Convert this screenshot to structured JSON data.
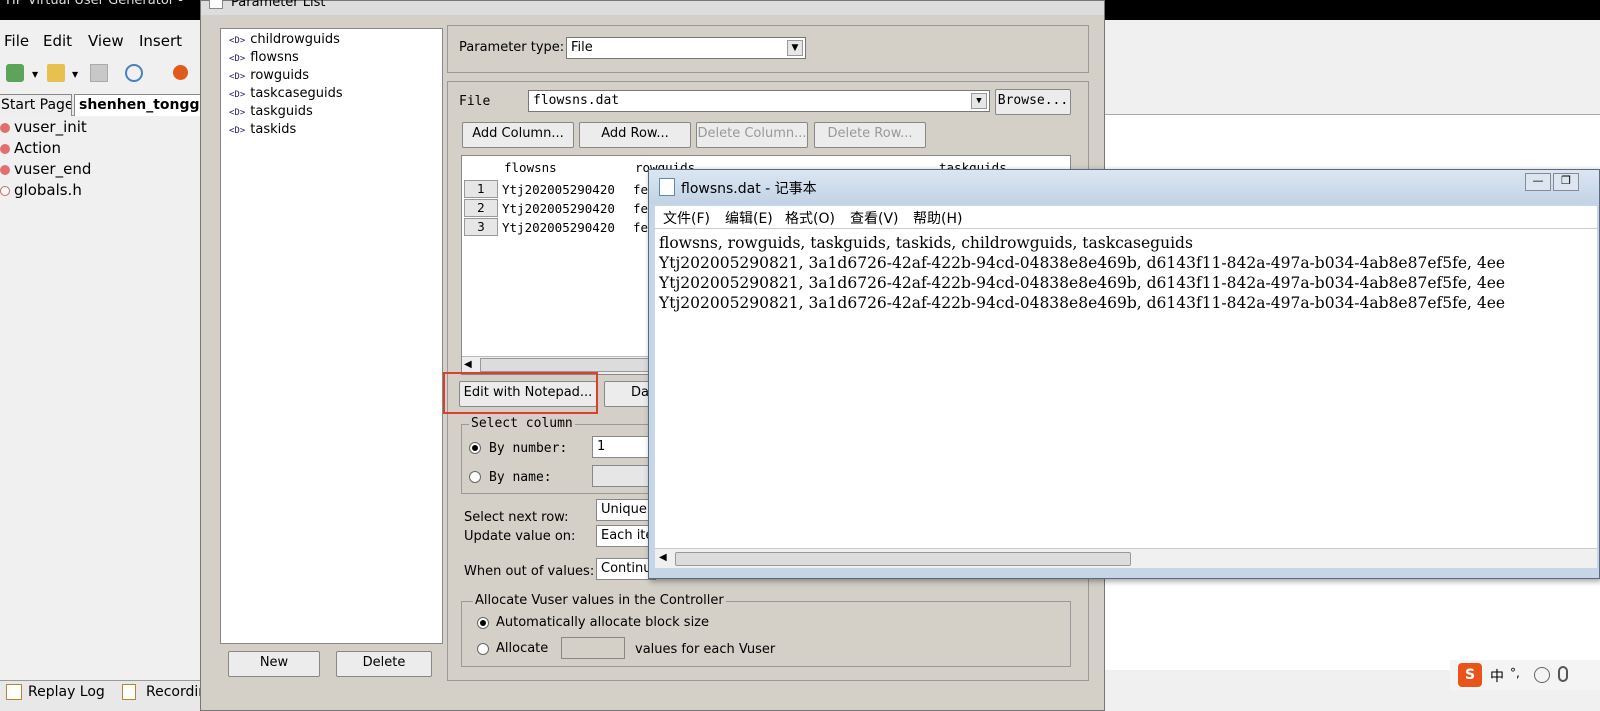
{
  "vugen": {
    "title": "HP Virtual User Generator -",
    "menu": [
      "File",
      "Edit",
      "View",
      "Insert"
    ],
    "tabs": [
      "Start Page",
      "shenhen_tongg"
    ],
    "tree": [
      "vuser_init",
      "Action",
      "vuser_end",
      "globals.h"
    ],
    "bottom_tabs": [
      "Replay Log",
      "Recordin"
    ]
  },
  "param_dialog": {
    "title": "Parameter List",
    "parameters": [
      "childrowguids",
      "flowsns",
      "rowguids",
      "taskcaseguids",
      "taskguids",
      "taskids"
    ],
    "param_tag": "<D>",
    "new_label": "New",
    "delete_label": "Delete",
    "parameter_type_label": "Parameter type:",
    "parameter_type_value": "File",
    "file_label": "File",
    "file_value": "flowsns.dat",
    "browse_label": "Browse...",
    "add_column_label": "Add Column...",
    "add_row_label": "Add Row...",
    "delete_column_label": "Delete Column...",
    "delete_row_label": "Delete Row...",
    "grid": {
      "columns": [
        "flowsns",
        "rowguids",
        "taskguids"
      ],
      "rows": [
        {
          "num": "1",
          "flowsns": "Ytj202005290420",
          "rowguids": "fe"
        },
        {
          "num": "2",
          "flowsns": "Ytj202005290420",
          "rowguids": "fe"
        },
        {
          "num": "3",
          "flowsns": "Ytj202005290420",
          "rowguids": "fe"
        }
      ]
    },
    "edit_notepad_label": "Edit with Notepad...",
    "data_wizard_partial": "Da",
    "select_column_label": "Select column",
    "by_number_label": "By number:",
    "by_number_value": "1",
    "by_name_label": "By name:",
    "select_next_row_label": "Select next row:",
    "select_next_row_value": "Unique",
    "update_value_label": "Update value on:",
    "update_value_value": "Each ite",
    "out_of_values_label": "When out of values:",
    "out_of_values_value": "Continue",
    "allocate_group_label": "Allocate Vuser values in the Controller",
    "auto_allocate_label": "Automatically allocate block size",
    "allocate_label": "Allocate",
    "values_each_label": "values for each Vuser"
  },
  "notepad": {
    "title": "flowsns.dat - 记事本",
    "menu": [
      "文件(F)",
      "编辑(E)",
      "格式(O)",
      "查看(V)",
      "帮助(H)"
    ],
    "lines": [
      "flowsns, rowguids, taskguids, taskids, childrowguids, taskcaseguids",
      "Ytj202005290821, 3a1d6726-42af-422b-94cd-04838e8e469b, d6143f11-842a-497a-b034-4ab8e87ef5fe, 4ee",
      "Ytj202005290821, 3a1d6726-42af-422b-94cd-04838e8e469b, d6143f11-842a-497a-b034-4ab8e87ef5fe, 4ee",
      "Ytj202005290821, 3a1d6726-42af-422b-94cd-04838e8e469b, d6143f11-842a-497a-b034-4ab8e87ef5fe, 4ee"
    ]
  },
  "sysbar": {
    "ime": "中",
    "ime_extra": "°,"
  },
  "colors": {
    "highlight": "#d9402f",
    "record_dot": "#e05a1b"
  }
}
